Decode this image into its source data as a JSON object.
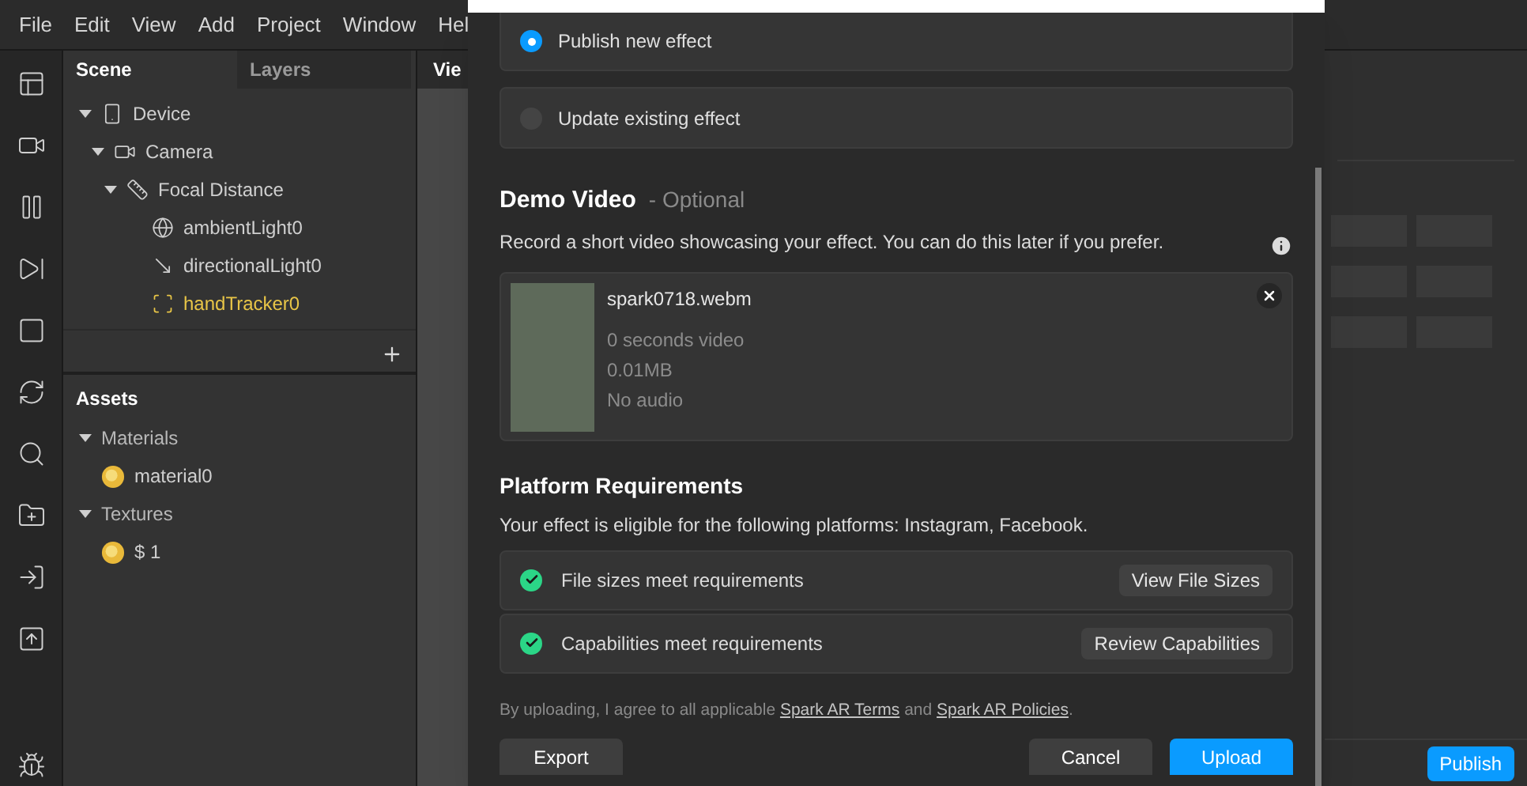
{
  "menu_bar": [
    "File",
    "Edit",
    "View",
    "Add",
    "Project",
    "Window",
    "Hel"
  ],
  "scene_panel": {
    "tabs": [
      {
        "label": "Scene",
        "selected": true
      },
      {
        "label": "Layers",
        "selected": false
      }
    ],
    "tree": [
      {
        "label": "Device",
        "kind": "device",
        "selected": false,
        "expanded": true,
        "children": [
          {
            "label": "Camera",
            "kind": "camera",
            "selected": false,
            "expanded": true,
            "children": [
              {
                "label": "Focal Distance",
                "kind": "focal",
                "selected": false,
                "expanded": true,
                "children": [
                  {
                    "label": "ambientLight0",
                    "kind": "ambient",
                    "selected": false
                  },
                  {
                    "label": "directionalLight0",
                    "kind": "directional",
                    "selected": false
                  },
                  {
                    "label": "handTracker0",
                    "kind": "tracker",
                    "selected": true
                  }
                ]
              }
            ]
          }
        ]
      }
    ]
  },
  "assets": {
    "title": "Assets",
    "groups": [
      {
        "label": "Materials",
        "expanded": true,
        "children": [
          {
            "label": "material0"
          }
        ]
      },
      {
        "label": "Textures",
        "expanded": true,
        "children": [
          {
            "label": "$ 1"
          }
        ]
      }
    ]
  },
  "viewport": {
    "title": "Vie"
  },
  "dialog": {
    "options": [
      {
        "label": "Publish new effect",
        "selected": true
      },
      {
        "label": "Update existing effect",
        "selected": false
      }
    ],
    "demo_video": {
      "title": "Demo Video",
      "subtitle": "- Optional",
      "description": "Record a short video showcasing your effect. You can do this later if you prefer.",
      "file": {
        "name": "spark0718.webm",
        "details": [
          "0 seconds video",
          "0.01MB",
          "No audio"
        ]
      }
    },
    "platform": {
      "title": "Platform Requirements",
      "description": "Your effect is eligible for the following platforms: Instagram, Facebook.",
      "checks": [
        {
          "label": "File sizes meet requirements",
          "passed": true,
          "action": "View File Sizes"
        },
        {
          "label": "Capabilities meet requirements",
          "passed": true,
          "action": "Review Capabilities"
        }
      ]
    },
    "terms": {
      "before": "By uploading, I agree to all applicable",
      "link1": "Spark AR Terms",
      "middle": "and",
      "link2": "Spark AR Policies",
      "after": "."
    },
    "buttons": [
      {
        "label": "Export",
        "kind": "secondary"
      },
      {
        "label": "Cancel",
        "kind": "secondary"
      },
      {
        "label": "Upload",
        "kind": "primary"
      }
    ]
  },
  "inspector": {
    "publish_button": "Publish"
  }
}
